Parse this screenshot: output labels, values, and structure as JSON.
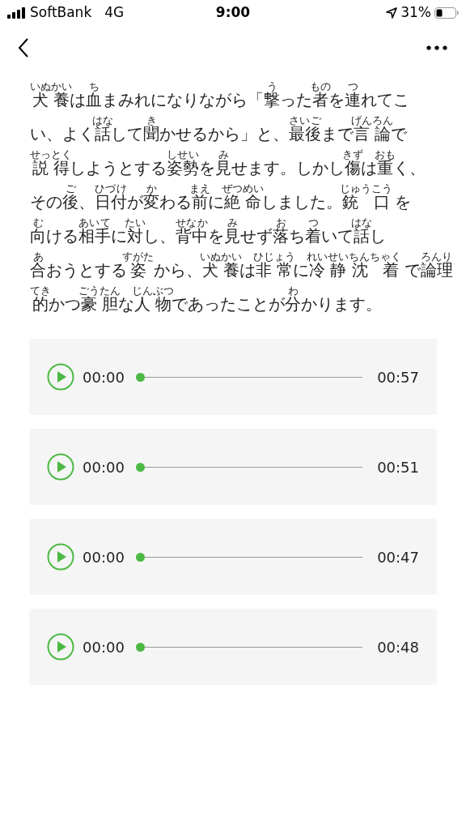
{
  "status_bar": {
    "carrier": "SoftBank",
    "network": "4G",
    "time": "9:00",
    "battery": "31%"
  },
  "paragraph": {
    "lines": [
      [
        {
          "t": "犬養",
          "r": "いぬかい"
        },
        {
          "t": "は"
        },
        {
          "t": "血",
          "r": "ち"
        },
        {
          "t": "まみれになりながら「"
        },
        {
          "t": "撃",
          "r": "う"
        },
        {
          "t": "った"
        },
        {
          "t": "者",
          "r": "もの"
        },
        {
          "t": "を"
        },
        {
          "t": "連",
          "r": "つ"
        },
        {
          "t": "れてこ"
        }
      ],
      [
        {
          "t": "い、よく"
        },
        {
          "t": "話",
          "r": "はな"
        },
        {
          "t": "して"
        },
        {
          "t": "聞",
          "r": "き"
        },
        {
          "t": "かせるから」と、"
        },
        {
          "t": "最後",
          "r": "さいご"
        },
        {
          "t": "まで"
        },
        {
          "t": "言論",
          "r": "げんろん"
        },
        {
          "t": "で"
        }
      ],
      [
        {
          "t": "説得",
          "r": "せっとく"
        },
        {
          "t": "しようとする"
        },
        {
          "t": "姿勢",
          "r": "しせい"
        },
        {
          "t": "を"
        },
        {
          "t": "見",
          "r": "み"
        },
        {
          "t": "せます。しかし"
        },
        {
          "t": "傷",
          "r": "きず"
        },
        {
          "t": "は"
        },
        {
          "t": "重",
          "r": "おも"
        },
        {
          "t": "く、"
        }
      ],
      [
        {
          "t": "その"
        },
        {
          "t": "後",
          "r": "ご"
        },
        {
          "t": "、"
        },
        {
          "t": "日付",
          "r": "ひづけ"
        },
        {
          "t": "が"
        },
        {
          "t": "変",
          "r": "か"
        },
        {
          "t": "わる"
        },
        {
          "t": "前",
          "r": "まえ"
        },
        {
          "t": "に"
        },
        {
          "t": "絶命",
          "r": "ぜつめい"
        },
        {
          "t": "しました。"
        },
        {
          "t": "銃 口",
          "r": "じゅうこう"
        },
        {
          "t": " を"
        }
      ],
      [
        {
          "t": "向",
          "r": "む"
        },
        {
          "t": "ける"
        },
        {
          "t": "相手",
          "r": "あいて"
        },
        {
          "t": "に"
        },
        {
          "t": "対",
          "r": "たい"
        },
        {
          "t": "し、"
        },
        {
          "t": "背中",
          "r": "せなか"
        },
        {
          "t": "を"
        },
        {
          "t": "見",
          "r": "み"
        },
        {
          "t": "せず"
        },
        {
          "t": "落",
          "r": "お"
        },
        {
          "t": "ち"
        },
        {
          "t": "着",
          "r": "つ"
        },
        {
          "t": "いて"
        },
        {
          "t": "話",
          "r": "はな"
        },
        {
          "t": "し"
        }
      ],
      [
        {
          "t": "合",
          "r": "あ"
        },
        {
          "t": "おうとする"
        },
        {
          "t": "姿",
          "r": "すがた"
        },
        {
          "t": " から、"
        },
        {
          "t": "犬養",
          "r": "いぬかい"
        },
        {
          "t": "は"
        },
        {
          "t": "非常",
          "r": "ひじょう"
        },
        {
          "t": "に"
        },
        {
          "t": "冷静沈 着",
          "r": "れいせいちんちゃく"
        },
        {
          "t": " で"
        },
        {
          "t": "論理",
          "r": "ろんり"
        }
      ],
      [
        {
          "t": "的",
          "r": "てき"
        },
        {
          "t": "かつ"
        },
        {
          "t": "豪胆",
          "r": "ごうたん"
        },
        {
          "t": "な"
        },
        {
          "t": "人物",
          "r": "じんぶつ"
        },
        {
          "t": "であったことが"
        },
        {
          "t": "分",
          "r": "わ"
        },
        {
          "t": "かります。"
        }
      ]
    ]
  },
  "audio_players": [
    {
      "current": "00:00",
      "duration": "00:57",
      "level": 0
    },
    {
      "current": "00:00",
      "duration": "00:51",
      "level": 0
    },
    {
      "current": "00:00",
      "duration": "00:47",
      "level": 0
    },
    {
      "current": "00:00",
      "duration": "00:48",
      "level": 0
    }
  ]
}
